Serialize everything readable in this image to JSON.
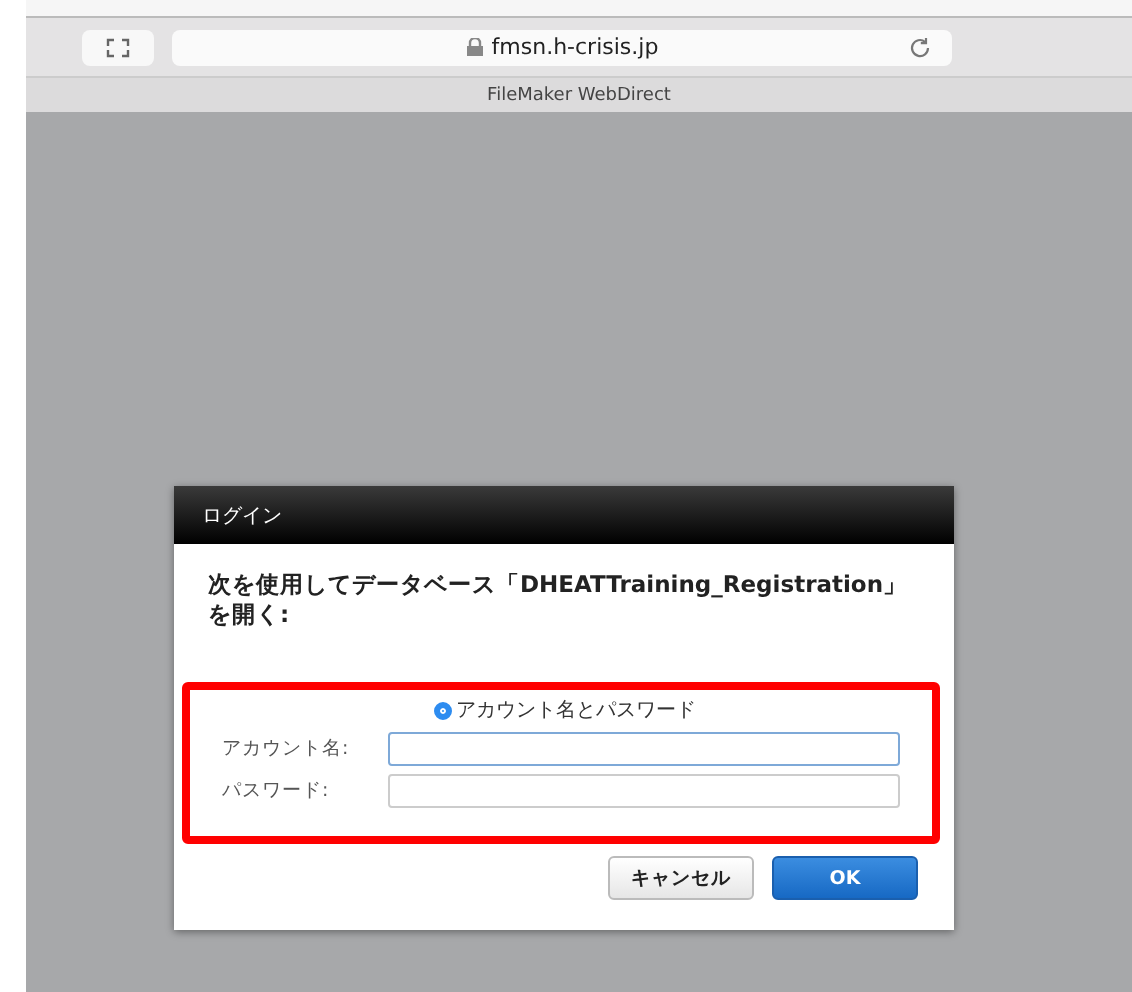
{
  "browser": {
    "url": "fmsn.h-crisis.jp",
    "page_title": "FileMaker WebDirect"
  },
  "dialog": {
    "title": "ログイン",
    "message": "次を使用してデータベース「DHEATTraining_Registration」を開く:",
    "login_options": [
      {
        "label": "アカウント名とパスワード",
        "selected": true
      }
    ],
    "fields": [
      {
        "label": "アカウント名:",
        "focused": true
      },
      {
        "label": "パスワード:",
        "focused": false
      }
    ],
    "buttons": [
      {
        "label": "キャンセル",
        "kind": "secondary"
      },
      {
        "label": "OK",
        "kind": "primary"
      }
    ]
  }
}
